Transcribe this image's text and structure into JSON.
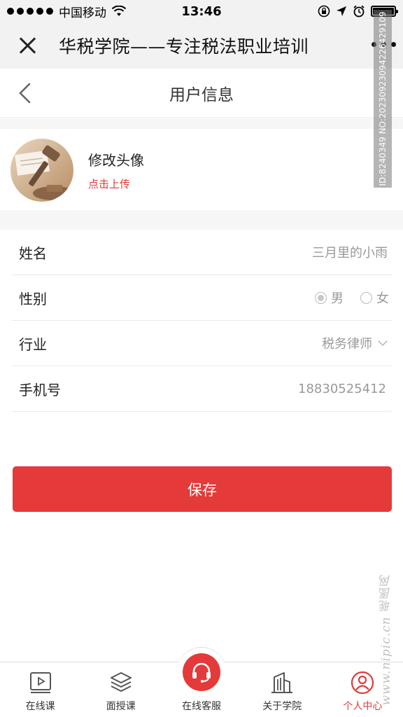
{
  "status_bar": {
    "carrier": "中国移动",
    "time": "13:46"
  },
  "header": {
    "title": "华税学院——专注税法职业培训"
  },
  "page": {
    "title": "用户信息"
  },
  "avatar": {
    "title": "修改头像",
    "action": "点击上传"
  },
  "form": {
    "name_label": "姓名",
    "name_value": "三月里的小雨",
    "gender_label": "性别",
    "gender_options": [
      "男",
      "女"
    ],
    "industry_label": "行业",
    "industry_value": "税务律师",
    "phone_label": "手机号",
    "phone_value": "18830525412"
  },
  "save_label": "保存",
  "tabs": [
    {
      "label": "在线课",
      "icon": "video-course-icon"
    },
    {
      "label": "面授课",
      "icon": "layers-icon"
    },
    {
      "label": "在线客服",
      "icon": "headset-icon"
    },
    {
      "label": "关于学院",
      "icon": "building-icon"
    },
    {
      "label": "个人中心",
      "icon": "user-icon"
    }
  ],
  "colors": {
    "accent": "#e43a3a",
    "muted_text": "#999999",
    "background_gray": "#f2f2f2"
  },
  "watermark": {
    "id": "ID:8240349 NO:20230923094226429109",
    "site": "www.nipic.cn 昵图网"
  }
}
